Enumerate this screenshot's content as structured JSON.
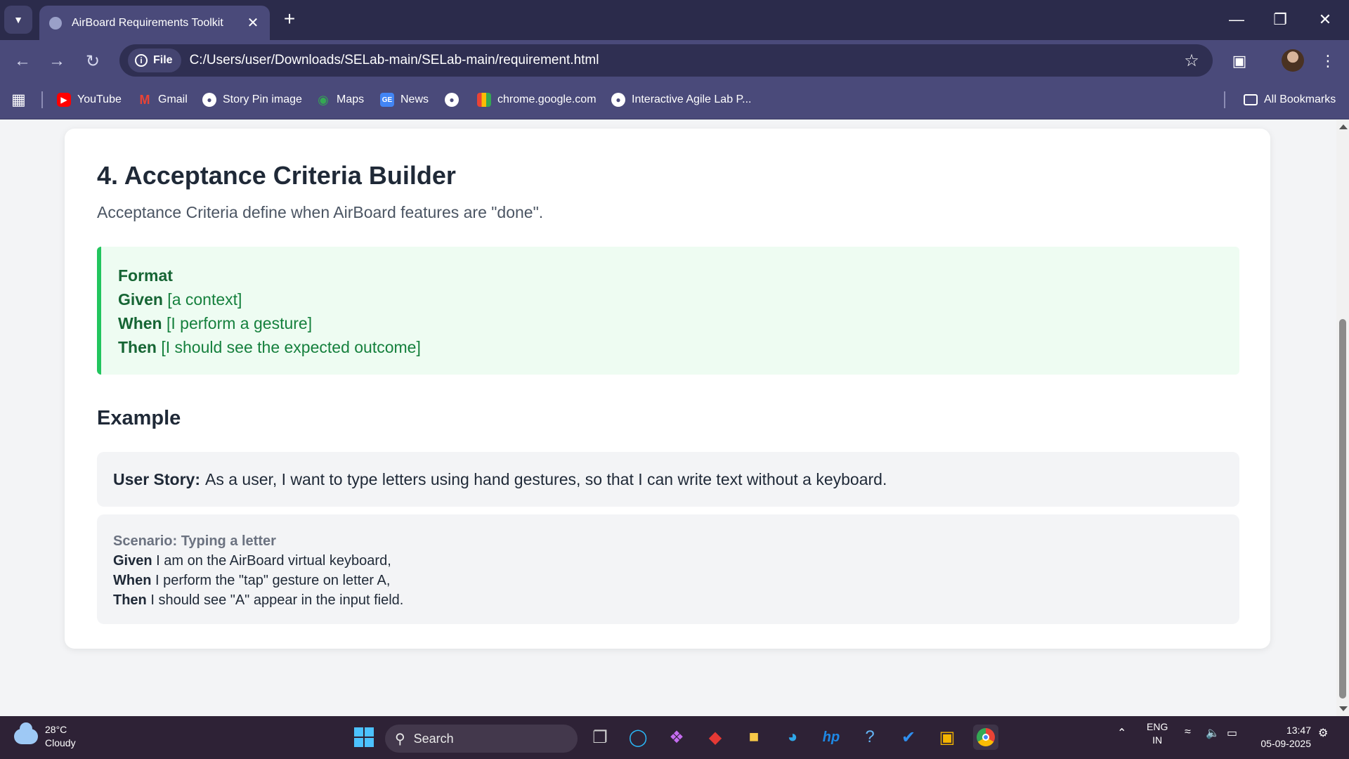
{
  "browser": {
    "tab_title": "AirBoard Requirements Toolkit",
    "site_chip": "File",
    "url": "C:/Users/user/Downloads/SELab-main/SELab-main/requirement.html",
    "bookmarks": [
      {
        "label": "YouTube",
        "icon": "youtube-icon",
        "color": "#ff0000"
      },
      {
        "label": "Gmail",
        "icon": "gmail-icon",
        "color": "#ea4335"
      },
      {
        "label": "Story Pin image",
        "icon": "globe-icon",
        "color": "#ffffff"
      },
      {
        "label": "Maps",
        "icon": "maps-icon",
        "color": "#34a853"
      },
      {
        "label": "News",
        "icon": "news-icon",
        "color": "#4285f4"
      },
      {
        "label": "",
        "icon": "globe-icon",
        "color": "#ffffff"
      },
      {
        "label": "chrome.google.com",
        "icon": "chrome-store-icon",
        "color": "#fbbc04"
      },
      {
        "label": "Interactive Agile Lab P...",
        "icon": "globe-icon",
        "color": "#ffffff"
      }
    ],
    "all_bookmarks": "All Bookmarks"
  },
  "page": {
    "heading": "4. Acceptance Criteria Builder",
    "lead": "Acceptance Criteria define when AirBoard features are \"done\".",
    "format": {
      "title": "Format",
      "lines": [
        {
          "keyword": "Given",
          "text": " [a context]"
        },
        {
          "keyword": "When",
          "text": " [I perform a gesture]"
        },
        {
          "keyword": "Then",
          "text": " [I should see the expected outcome]"
        }
      ]
    },
    "example_heading": "Example",
    "story": {
      "label": "User Story:",
      "text": "As a user, I want to type letters using hand gestures, so that I can write text without a keyboard."
    },
    "scenario": {
      "title": "Scenario: Typing a letter",
      "lines": [
        {
          "keyword": "Given",
          "text": " I am on the AirBoard virtual keyboard,"
        },
        {
          "keyword": "When",
          "text": " I perform the \"tap\" gesture on letter A,"
        },
        {
          "keyword": "Then",
          "text": " I should see \"A\" appear in the input field."
        }
      ]
    }
  },
  "taskbar": {
    "weather_temp": "28°C",
    "weather_desc": "Cloudy",
    "search_placeholder": "Search",
    "lang_top": "ENG",
    "lang_bottom": "IN",
    "time": "13:47",
    "date": "05-09-2025"
  },
  "colors": {
    "accent_green": "#22c55e",
    "format_bg": "#eefcf2",
    "chrome_purple": "#4a4a7a",
    "taskbar_bg": "#2e2236"
  }
}
